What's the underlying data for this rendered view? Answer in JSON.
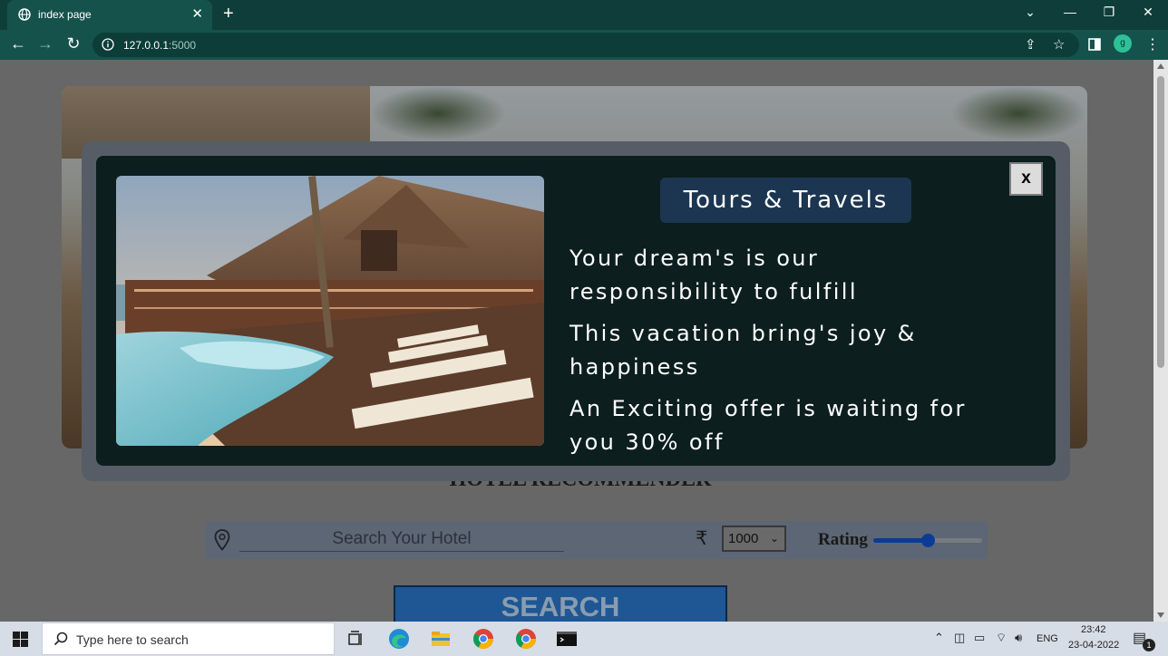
{
  "browser": {
    "tab_title": "index page",
    "tab_close": "✕",
    "new_tab": "+",
    "url_host": "127.0.0.1",
    "url_port": ":5000",
    "profile_initial": "g",
    "window_controls": {
      "tabsearch": "⌄",
      "minimize": "—",
      "restore": "❐",
      "close": "✕"
    }
  },
  "page": {
    "heading": "HOTEL RECOMMENDER",
    "search": {
      "placeholder": "Search Your Hotel",
      "currency_symbol": "₹",
      "price_selected": "1000",
      "rating_label": "Rating",
      "rating_level_fraction": 0.5
    },
    "search_button": "SEARCH"
  },
  "popup": {
    "close_label": "x",
    "title": "Tours & Travels",
    "lines": [
      "Your dream's is our",
      "responsibility to fulfill",
      "This vacation bring's joy &",
      "happiness",
      "An Exciting offer is waiting for",
      "you 30% off"
    ]
  },
  "taskbar": {
    "search_placeholder": "Type here to search",
    "language": "ENG",
    "time": "23:42",
    "date": "23-04-2022",
    "notification_count": "1"
  },
  "colors": {
    "chrome_accent": "#15524c",
    "popup_bg": "#0c1e1e",
    "popup_title_bg": "#1c3551",
    "search_button_bg": "#1f5a99",
    "slider": "#0d3d9c"
  },
  "icons": [
    "globe-icon",
    "back-arrow-icon",
    "forward-arrow-icon",
    "reload-icon",
    "info-icon",
    "share-icon",
    "star-icon",
    "sidepanel-icon",
    "kebab-menu-icon",
    "location-pin-icon",
    "windows-start-icon",
    "search-icon",
    "task-view-icon",
    "edge-icon",
    "file-explorer-icon",
    "chrome-icon",
    "terminal-icon"
  ]
}
